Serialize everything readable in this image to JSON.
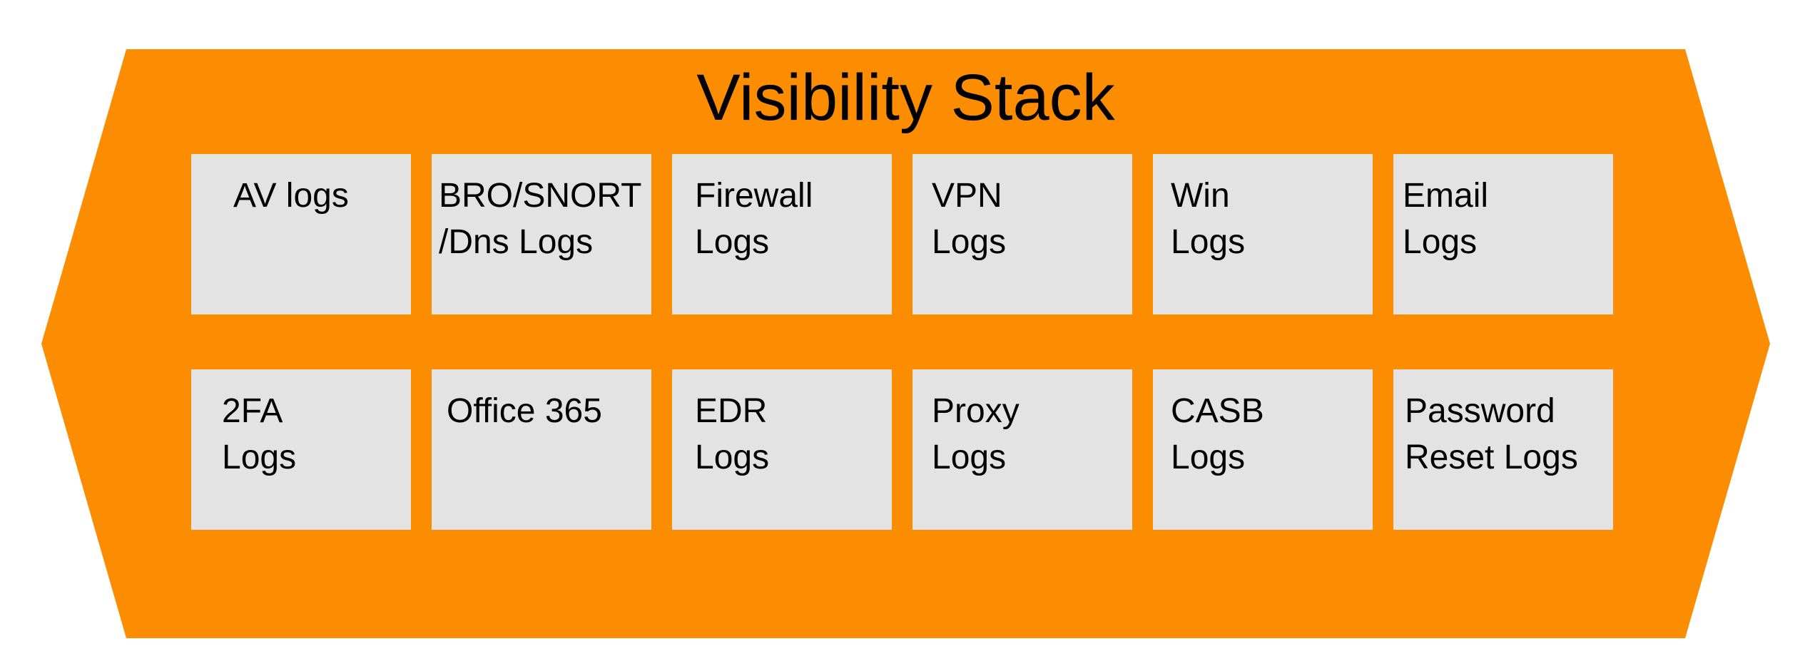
{
  "diagram": {
    "title": "Visibility Stack",
    "colors": {
      "container": "#fc8c00",
      "tile": "#e3e3e3",
      "text": "#000000"
    },
    "rows": [
      {
        "tiles": [
          {
            "label": "AV logs"
          },
          {
            "label": "BRO/SNORT\n/Dns Logs"
          },
          {
            "label": "Firewall\nLogs"
          },
          {
            "label": "VPN\nLogs"
          },
          {
            "label": "Win\nLogs"
          },
          {
            "label": "Email\nLogs"
          }
        ]
      },
      {
        "tiles": [
          {
            "label": "2FA\nLogs"
          },
          {
            "label": "Office 365"
          },
          {
            "label": "EDR\nLogs"
          },
          {
            "label": "Proxy\nLogs"
          },
          {
            "label": "CASB\nLogs"
          },
          {
            "label": "Password\nReset Logs"
          }
        ]
      }
    ]
  }
}
